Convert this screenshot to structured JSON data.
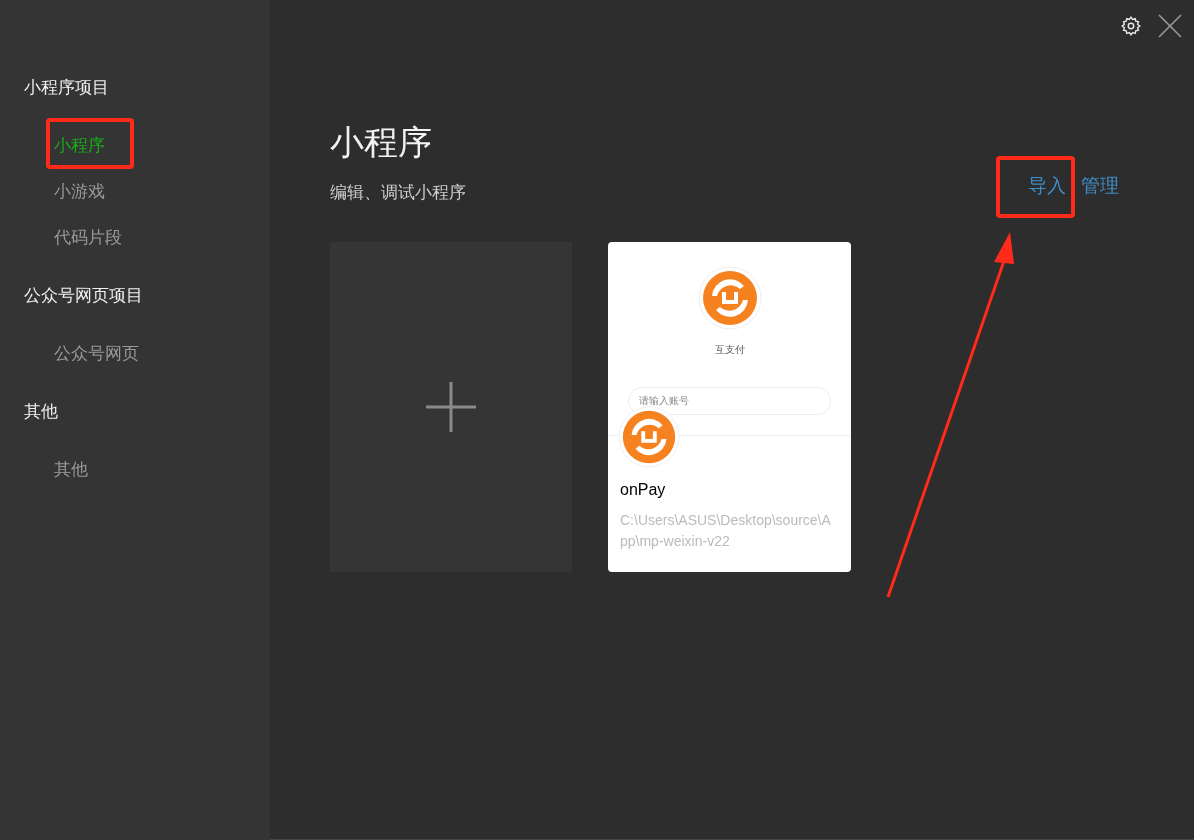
{
  "sidebar": {
    "groups": [
      {
        "title": "小程序项目",
        "items": [
          {
            "label": "小程序",
            "selected": true
          },
          {
            "label": "小游戏",
            "selected": false
          },
          {
            "label": "代码片段",
            "selected": false
          }
        ]
      },
      {
        "title": "公众号网页项目",
        "items": [
          {
            "label": "公众号网页",
            "selected": false
          }
        ]
      },
      {
        "title": "其他",
        "items": [
          {
            "label": "其他",
            "selected": false
          }
        ]
      }
    ]
  },
  "main": {
    "title": "小程序",
    "subtitle": "编辑、调试小程序",
    "actions": [
      "导入",
      "管理"
    ],
    "projects": [
      {
        "name": "onPay",
        "path": "C:\\Users\\ASUS\\Desktop\\source\\App\\mp-weixin-v22",
        "preview": {
          "app_name": "互支付",
          "placeholder": "请输入账号"
        }
      }
    ]
  }
}
